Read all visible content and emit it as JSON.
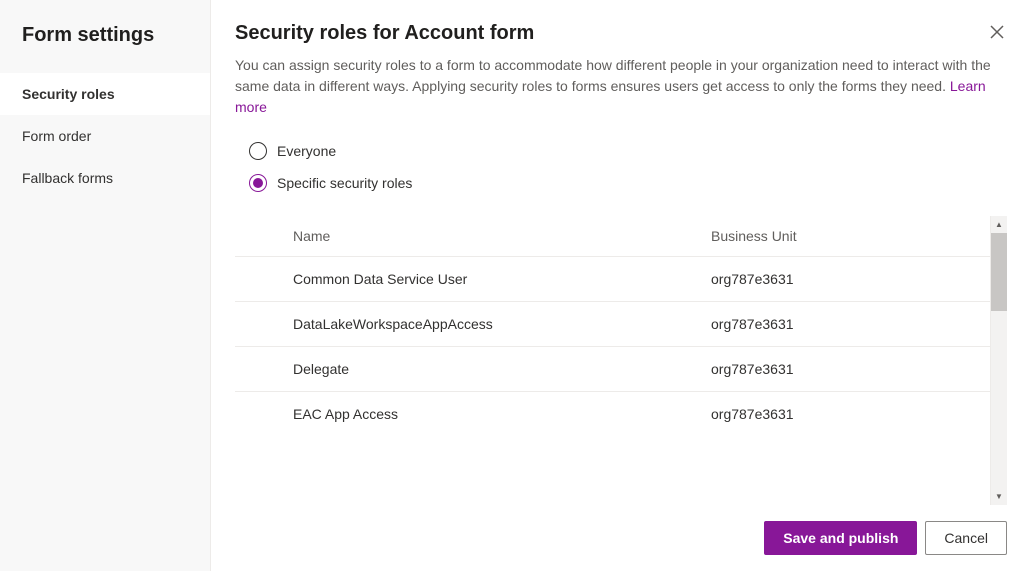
{
  "sidebar": {
    "title": "Form settings",
    "items": [
      {
        "label": "Security roles",
        "active": true
      },
      {
        "label": "Form order",
        "active": false
      },
      {
        "label": "Fallback forms",
        "active": false
      }
    ]
  },
  "header": {
    "title": "Security roles for Account form"
  },
  "description": "You can assign security roles to a form to accommodate how different people in your organization need to interact with the same data in different ways. Applying security roles to forms ensures users get access to only the forms they need. ",
  "learn_more_label": "Learn more",
  "radio": {
    "options": [
      {
        "label": "Everyone",
        "selected": false
      },
      {
        "label": "Specific security roles",
        "selected": true
      }
    ]
  },
  "table": {
    "columns": {
      "name": "Name",
      "business_unit": "Business Unit"
    },
    "rows": [
      {
        "name": "Common Data Service User",
        "business_unit": "org787e3631"
      },
      {
        "name": "DataLakeWorkspaceAppAccess",
        "business_unit": "org787e3631"
      },
      {
        "name": "Delegate",
        "business_unit": "org787e3631"
      },
      {
        "name": "EAC App Access",
        "business_unit": "org787e3631"
      }
    ]
  },
  "footer": {
    "save_label": "Save and publish",
    "cancel_label": "Cancel"
  }
}
